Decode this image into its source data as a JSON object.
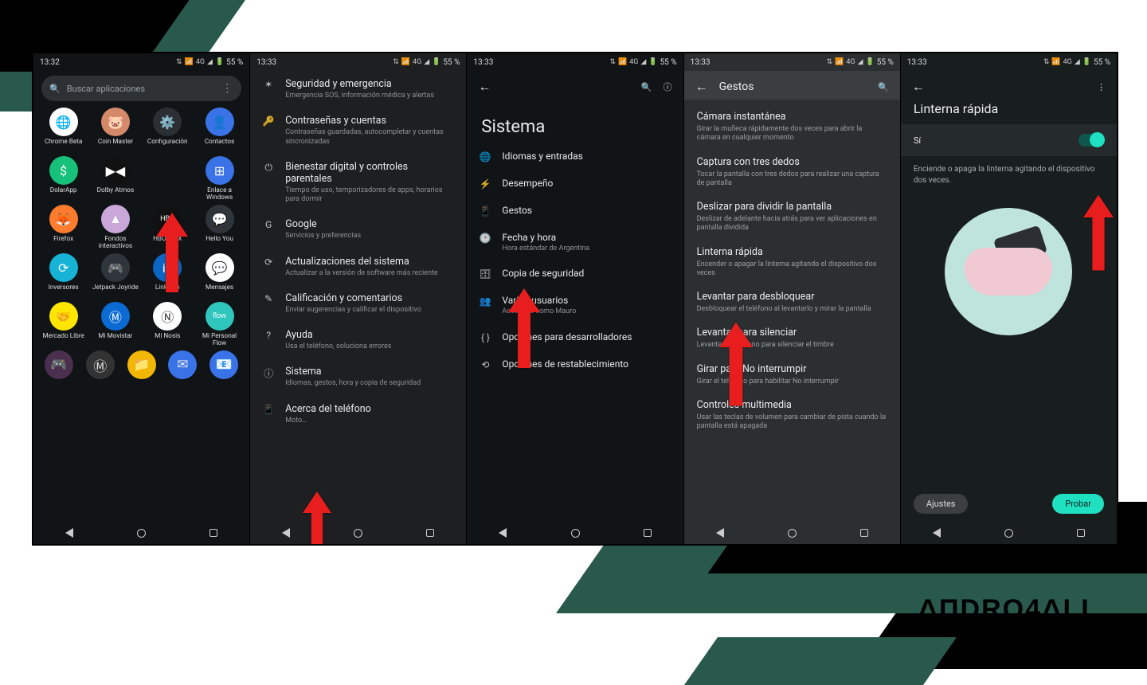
{
  "brand": "ΔΠDRO4ΔLL",
  "status": {
    "time1": "13:32",
    "time": "13:33",
    "battery": "55 %",
    "sig": [
      "⇅",
      "▾",
      "📶",
      "4G",
      "◢",
      "🔋"
    ]
  },
  "s1": {
    "search_placeholder": "Buscar aplicaciones",
    "apps": [
      {
        "label": "Chrome Beta",
        "bg": "#fff",
        "glyph": "🌐"
      },
      {
        "label": "Coin Master",
        "bg": "#d48a6a",
        "glyph": "🐷"
      },
      {
        "label": "Configuración",
        "bg": "#2b2f33",
        "glyph": "⚙️"
      },
      {
        "label": "Contactos",
        "bg": "#3a73e8",
        "glyph": "👤"
      },
      {
        "label": "DolarApp",
        "bg": "#17c17a",
        "glyph": "$"
      },
      {
        "label": "Dolby Atmos",
        "bg": "#111",
        "glyph": "▶◀"
      },
      {
        "label": "",
        "bg": "transparent",
        "glyph": ""
      },
      {
        "label": "Enlace a Windows",
        "bg": "#3a73e8",
        "glyph": "⊞"
      },
      {
        "label": "Firefox",
        "bg": "#ff7b2e",
        "glyph": "🦊"
      },
      {
        "label": "Fondos interactivos",
        "bg": "#caa7d9",
        "glyph": "▲"
      },
      {
        "label": "HBO MAX",
        "bg": "#111",
        "glyph": "HBO"
      },
      {
        "label": "Hello You",
        "bg": "#2f353a",
        "glyph": "💬"
      },
      {
        "label": "Inversores",
        "bg": "#17b3d6",
        "glyph": "⟳"
      },
      {
        "label": "Jetpack Joyride",
        "bg": "#2f353a",
        "glyph": "🎮"
      },
      {
        "label": "LinkedIn",
        "bg": "#0a66c2",
        "glyph": "in"
      },
      {
        "label": "Mensajes",
        "bg": "#fff",
        "glyph": "💬"
      },
      {
        "label": "Mercado Libre",
        "bg": "#ffe600",
        "glyph": "🤝"
      },
      {
        "label": "Mi Movistar",
        "bg": "#0b6bd3",
        "glyph": "Ⓜ"
      },
      {
        "label": "Mi Nosis",
        "bg": "#fff",
        "glyph": "Ⓝ"
      },
      {
        "label": "Mi Personal Flow",
        "bg": "#2fc7bd",
        "glyph": "flow"
      }
    ],
    "dock": [
      "bg:#4a2f4f|🎮",
      "bg:#333|Ⓜ",
      "bg:#f2b705|📁",
      "bg:#3a73e8|✉",
      "bg:#3a73e8|📧"
    ]
  },
  "s2": [
    {
      "ic": "✶",
      "h": "Seguridad y emergencia",
      "s": "Emergencia SOS, información médica y alertas"
    },
    {
      "ic": "🔑",
      "h": "Contraseñas y cuentas",
      "s": "Contraseñas guardadas, autocompletar y cuentas sincronizadas"
    },
    {
      "ic": "⏻",
      "h": "Bienestar digital y controles parentales",
      "s": "Tiempo de uso, temporizadores de apps, horarios para dormir"
    },
    {
      "ic": "G",
      "h": "Google",
      "s": "Servicios y preferencias"
    },
    {
      "ic": "⟳",
      "h": "Actualizaciones del sistema",
      "s": "Actualizar a la versión de software más reciente"
    },
    {
      "ic": "✎",
      "h": "Calificación y comentarios",
      "s": "Enviar sugerencias y calificar el dispositivo"
    },
    {
      "ic": "?",
      "h": "Ayuda",
      "s": "Usa el teléfono, soluciona errores"
    },
    {
      "ic": "ⓘ",
      "h": "Sistema",
      "s": "Idiomas, gestos, hora y copia de seguridad"
    },
    {
      "ic": "📱",
      "h": "Acerca del teléfono",
      "s": "Moto…"
    }
  ],
  "s3": {
    "title": "Sistema",
    "items": [
      {
        "ic": "🌐",
        "h": "Idiomas y entradas",
        "s": ""
      },
      {
        "ic": "⚡",
        "h": "Desempeño",
        "s": ""
      },
      {
        "ic": "📱",
        "h": "Gestos",
        "s": ""
      },
      {
        "ic": "🕑",
        "h": "Fecha y hora",
        "s": "Hora estándar de Argentina"
      },
      {
        "ic": "🗄",
        "h": "Copia de seguridad",
        "s": ""
      },
      {
        "ic": "👥",
        "h": "Varios usuarios",
        "s": "Accediste como Mauro"
      },
      {
        "ic": "{ }",
        "h": "Opciones para desarrolladores",
        "s": ""
      },
      {
        "ic": "⟲",
        "h": "Opciones de restablecimiento",
        "s": ""
      }
    ]
  },
  "s4": {
    "title": "Gestos",
    "items": [
      {
        "h": "Cámara instantánea",
        "s": "Girar la muñeca rápidamente dos veces para abrir la cámara en cualquier momento"
      },
      {
        "h": "Captura con tres dedos",
        "s": "Tocar la pantalla con tres dedos para realizar una captura de pantalla"
      },
      {
        "h": "Deslizar para dividir la pantalla",
        "s": "Deslizar de adelante hacia atrás para ver aplicaciones en pantalla dividida"
      },
      {
        "h": "Linterna rápida",
        "s": "Encender o apagar la linterna agitando el dispositivo dos veces"
      },
      {
        "h": "Levantar para desbloquear",
        "s": "Desbloquear el teléfono al levantarlo y mirar la pantalla"
      },
      {
        "h": "Levantar para silenciar",
        "s": "Levantar el teléfono para silenciar el timbre"
      },
      {
        "h": "Girar para No interrumpir",
        "s": "Girar el teléfono para habilitar No interrumpir"
      },
      {
        "h": "Controles multimedia",
        "s": "Usar las teclas de volumen para cambiar de pista cuando la pantalla está apagada"
      }
    ]
  },
  "s5": {
    "title": "Linterna rápida",
    "toggle_label": "Sí",
    "desc": "Enciende o apaga la linterna agitando el dispositivo dos veces.",
    "btn1": "Ajustes",
    "btn2": "Probar"
  }
}
